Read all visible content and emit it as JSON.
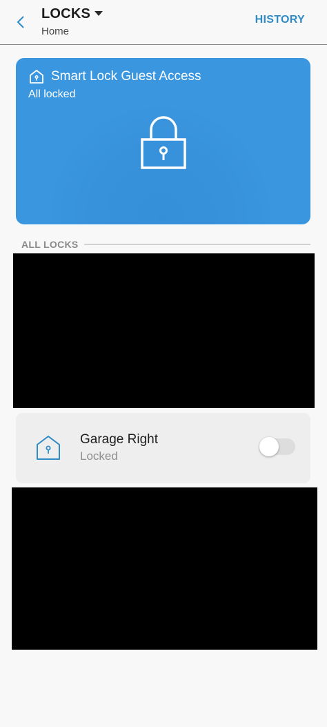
{
  "header": {
    "title": "LOCKS",
    "subtitle": "Home",
    "history_label": "HISTORY",
    "back_icon": "chevron-left-icon",
    "dropdown_icon": "caret-down-icon"
  },
  "guest_card": {
    "title": "Smart Lock Guest Access",
    "status": "All locked",
    "icon": "home-lock-icon",
    "lock_icon": "padlock-icon",
    "color": "#3a96de"
  },
  "all_locks": {
    "label": "ALL LOCKS",
    "items": [
      {
        "name": "Garage Right",
        "status": "Locked",
        "icon": "home-lock-icon",
        "toggle_on": false
      }
    ]
  },
  "colors": {
    "accent": "#2e8bc6",
    "card_blue": "#3a96de",
    "redaction": "#000000"
  }
}
